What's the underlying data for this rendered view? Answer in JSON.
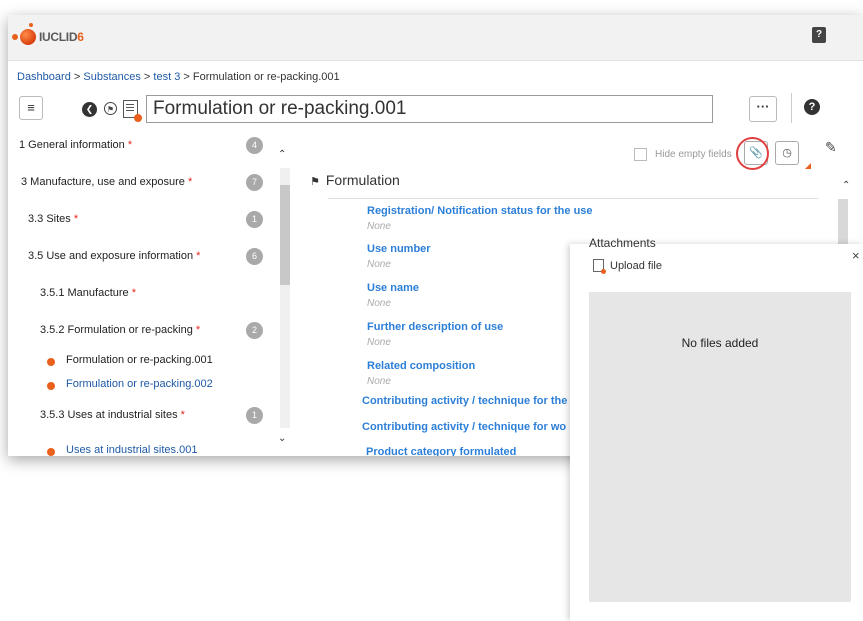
{
  "app": {
    "logo_text": "IUCLID",
    "logo_version": "6",
    "help_top": "?"
  },
  "breadcrumb": {
    "dashboard": "Dashboard",
    "sep1": " > ",
    "substances": "Substances",
    "sep2": " > ",
    "test": "test 3",
    "sep3": " > ",
    "current": "Formulation or re-packing.001"
  },
  "toolbar": {
    "menu_glyph": "≡",
    "title": "Formulation or re-packing.001",
    "more_glyph": "···",
    "help_glyph": "?"
  },
  "nav": {
    "items": [
      {
        "label": "1  General information",
        "req": " *",
        "badge": "4"
      },
      {
        "label": "3  Manufacture, use and exposure",
        "req": " *",
        "badge": "7"
      },
      {
        "label": "3.3  Sites",
        "req": " *",
        "badge": "1"
      },
      {
        "label": "3.5  Use and exposure information",
        "req": " *",
        "badge": "6"
      },
      {
        "label": "3.5.1  Manufacture",
        "req": " *",
        "badge": ""
      },
      {
        "label": "3.5.2  Formulation or re-packing",
        "req": " *",
        "badge": "2"
      },
      {
        "label": "Formulation or re-packing.001",
        "req": "",
        "badge": ""
      },
      {
        "label": "Formulation or re-packing.002",
        "req": "",
        "badge": ""
      },
      {
        "label": "3.5.3  Uses at industrial sites",
        "req": " *",
        "badge": "1"
      },
      {
        "label": "Uses at industrial sites.001",
        "req": "",
        "badge": ""
      }
    ]
  },
  "content": {
    "hide_empty_label": "Hide empty fields",
    "section_title": "Formulation",
    "fields": [
      {
        "label": "Registration/ Notification status for the use",
        "value": "None"
      },
      {
        "label": "Use number",
        "value": "None"
      },
      {
        "label": "Use name",
        "value": "None"
      },
      {
        "label": "Further description of use",
        "value": "None"
      },
      {
        "label": "Related composition",
        "value": "None"
      },
      {
        "label": "Contributing activity / technique for the",
        "value": ""
      },
      {
        "label": "Contributing activity / technique for wo",
        "value": ""
      },
      {
        "label": "Product category formulated",
        "value": ""
      }
    ]
  },
  "attachments": {
    "title": "Attachments",
    "upload_label": "Upload file",
    "empty_text": "No files added",
    "close_glyph": "×"
  },
  "colors": {
    "accent": "#e8601c",
    "link": "#1f5aa6",
    "field_label": "#2c7fd8",
    "required": "#e8261c",
    "highlight_circle": "#e04040"
  }
}
